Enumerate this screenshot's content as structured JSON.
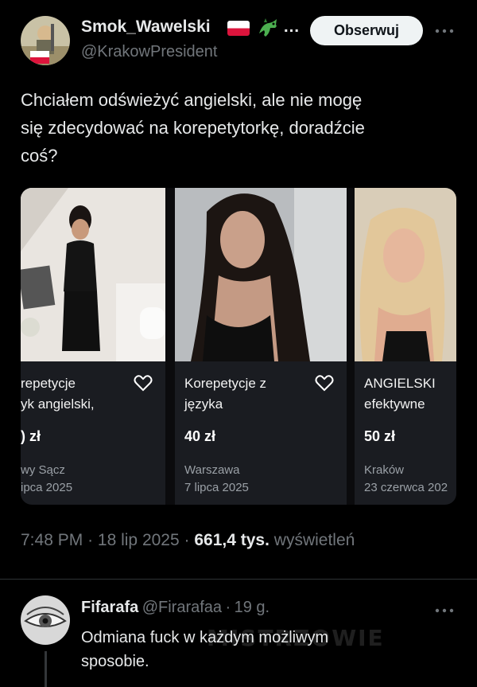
{
  "tweet": {
    "author_name": "Smok_Wawelski",
    "author_emoji_suffix": "…",
    "author_handle": "@KrakowPresident",
    "follow_label": "Obserwuj",
    "text_line1": "Chciałem odświeżyć angielski, ale nie mogę",
    "text_line2": "się zdecydować na korepetytorkę, doradźcie",
    "text_line3": "coś?",
    "time": "7:48 PM",
    "sep1": "·",
    "date": "18 lip 2025",
    "sep2": "·",
    "views_count": "661,4 tys.",
    "views_label": "wyświetleń"
  },
  "listings": [
    {
      "title1": "repetycje",
      "title2": "yk angielski,",
      "price": ") zł",
      "city": "wy Sącz",
      "date": "ipca 2025"
    },
    {
      "title1": "Korepetycje z",
      "title2": "języka",
      "price": "40 zł",
      "city": "Warszawa",
      "date": "7 lipca 2025"
    },
    {
      "title1": "ANGIELSKI",
      "title2": "efektywne",
      "price": "50 zł",
      "city": "Kraków",
      "date": "23 czerwca 202"
    }
  ],
  "reply": {
    "author_name": "Fifarafa",
    "author_handle": "@Firarafaa",
    "sep": "·",
    "age": "19 g.",
    "text_line1": "Odmiana fuck w każdym możliwym",
    "text_line2": "sposobie."
  },
  "watermark": "MISTRZOWIE",
  "icons": {
    "flag": "poland-flag-icon",
    "dragon": "dragon-emoji-icon",
    "heart": "heart-outline-icon",
    "more": "more-horizontal-icon"
  },
  "colors": {
    "background": "#000000",
    "text": "#e7e9ea",
    "secondary": "#71767b",
    "card": "#1a1c21",
    "follow_bg": "#eff3f4"
  }
}
